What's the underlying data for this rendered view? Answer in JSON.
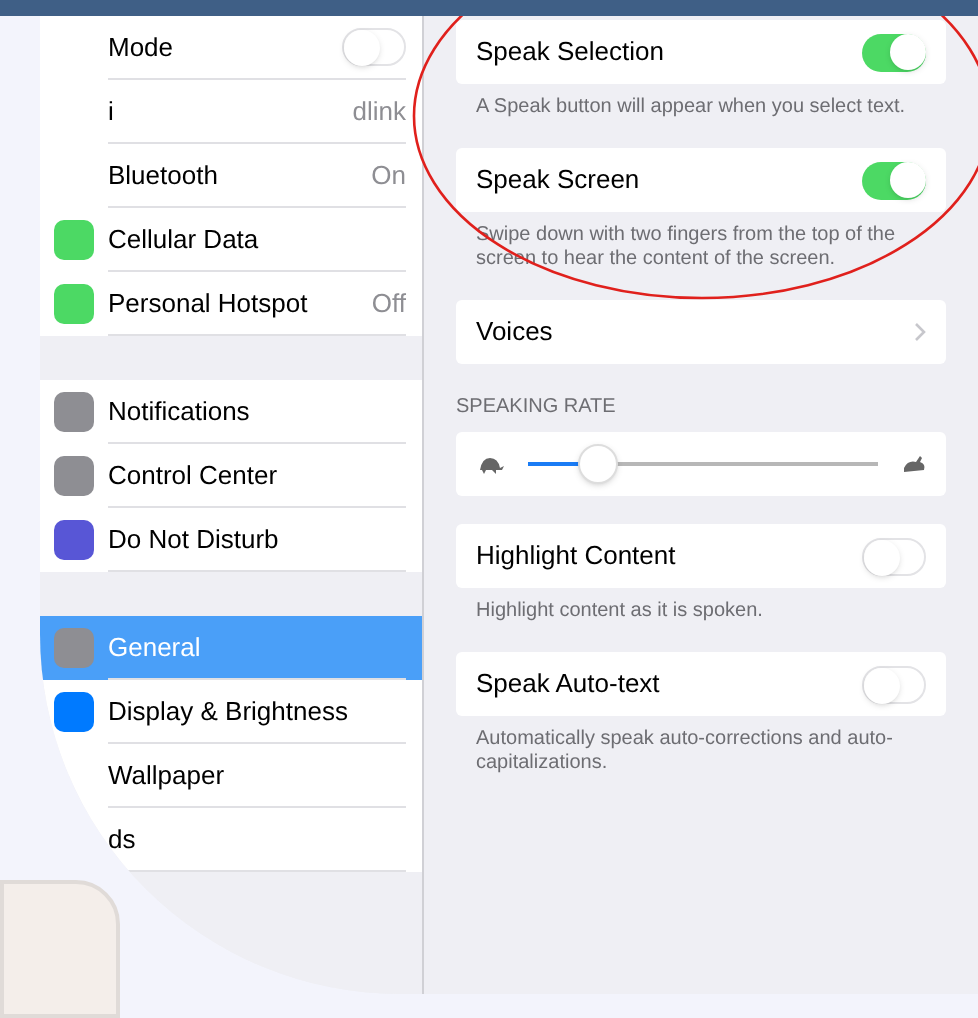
{
  "sidebar": {
    "groups": [
      [
        {
          "kind": "toggle",
          "label": "Mode",
          "on": false
        },
        {
          "kind": "value",
          "label": "i",
          "value": "dlink"
        },
        {
          "kind": "value",
          "label": "Bluetooth",
          "value": "On"
        },
        {
          "kind": "value",
          "label": "Cellular Data",
          "color": "#4cd964"
        },
        {
          "kind": "value",
          "label": "Personal Hotspot",
          "value": "Off",
          "color": "#4cd964"
        }
      ],
      [
        {
          "kind": "value",
          "label": "Notifications",
          "color": "#8e8e93"
        },
        {
          "kind": "value",
          "label": "Control Center",
          "color": "#8e8e93"
        },
        {
          "kind": "value",
          "label": "Do Not Disturb",
          "color": "#5856d6"
        }
      ],
      [
        {
          "kind": "value",
          "label": "General",
          "color": "#8e8e93",
          "selected": true
        },
        {
          "kind": "value",
          "label": "Display & Brightness",
          "color": "#007aff",
          "selected": false
        },
        {
          "kind": "value",
          "label": "Wallpaper",
          "selected": false
        },
        {
          "kind": "value",
          "label": "ds",
          "selected": false
        }
      ]
    ]
  },
  "detail": {
    "sections": [
      {
        "kind": "toggle",
        "label": "Speak Selection",
        "on": true,
        "footer": "A Speak button will appear when you select text."
      },
      {
        "kind": "toggle",
        "label": "Speak Screen",
        "on": true,
        "footer": "Swipe down with two fingers from the top of the screen to hear the content of the screen."
      },
      {
        "kind": "link",
        "label": "Voices"
      },
      {
        "kind": "slider",
        "header": "SPEAKING RATE",
        "level": 0.2
      },
      {
        "kind": "toggle",
        "label": "Highlight Content",
        "on": false,
        "footer": "Highlight content as it is spoken."
      },
      {
        "kind": "toggle",
        "label": "Speak Auto-text",
        "on": false,
        "footer": "Automatically speak auto-corrections and auto-capitalizations."
      }
    ]
  }
}
